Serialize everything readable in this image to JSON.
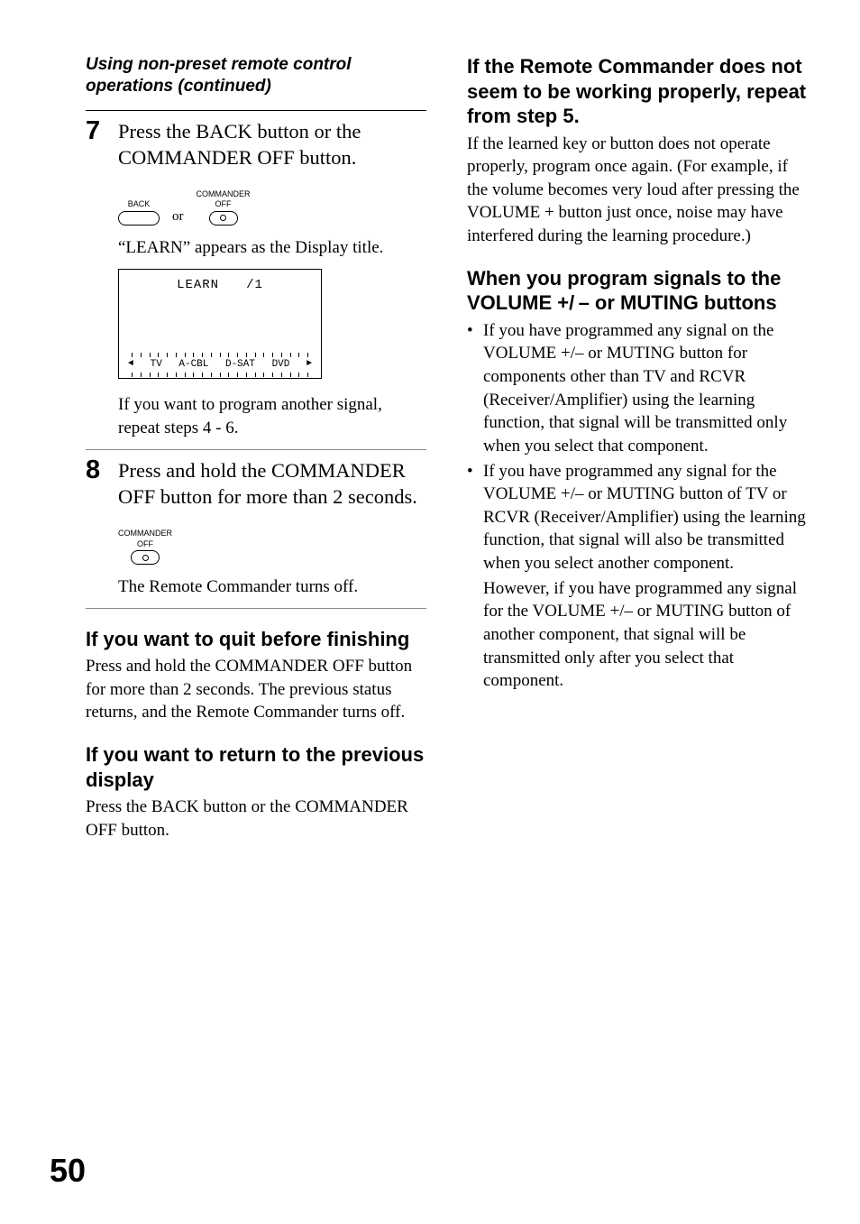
{
  "runningHead": "Using non-preset remote control operations (continued)",
  "step7": {
    "num": "7",
    "text": "Press the BACK button or the COMMANDER OFF button.",
    "backLabel": "BACK",
    "commanderOffLabel1": "COMMANDER",
    "commanderOffLabel2": "OFF",
    "or": "or",
    "learnAppears": "“LEARN” appears as the Display title.",
    "lcdLearn": "LEARN",
    "lcdSlash1": "/1",
    "lcdTV": "TV",
    "lcdACBL": "A-CBL",
    "lcdDSAT": "D-SAT",
    "lcdDVD": "DVD",
    "repeatText": "If you want to program another signal, repeat steps 4 - 6."
  },
  "step8": {
    "num": "8",
    "text": "Press and hold the COMMANDER OFF button for more than 2 seconds.",
    "commanderOffLabel1": "COMMANDER",
    "commanderOffLabel2": "OFF",
    "turnsOff": "The Remote Commander turns off."
  },
  "sec1": {
    "title": "If you want to quit before finishing",
    "body": "Press and hold the COMMANDER OFF button for more than 2 seconds. The previous status returns, and the Remote Commander turns off."
  },
  "sec2": {
    "title": "If you want to return to the previous display",
    "body": "Press the BACK button or the COMMANDER OFF button."
  },
  "sec3": {
    "title": "If the Remote Commander does not seem to be working properly, repeat from step 5.",
    "body": "If the learned key or button does not operate properly, program once again. (For example, if the volume becomes very loud after pressing the VOLUME + button just once, noise may have interfered during the learning procedure.)"
  },
  "sec4": {
    "title": "When you program signals to the VOLUME +/ – or MUTING buttons",
    "b1": "If you have programmed any signal on the VOLUME +/– or MUTING button for components other than TV and RCVR (Receiver/Amplifier) using the learning function, that signal will be transmitted only when you select that component.",
    "b2": "If you have programmed any signal for the VOLUME +/– or MUTING button of TV or RCVR (Receiver/Amplifier) using the learning function, that signal will also be transmitted when you select another component.",
    "b2cont": "However, if you have programmed any signal for the VOLUME +/– or MUTING button of another component, that signal will be transmitted only after you select that component."
  },
  "pageNum": "50"
}
